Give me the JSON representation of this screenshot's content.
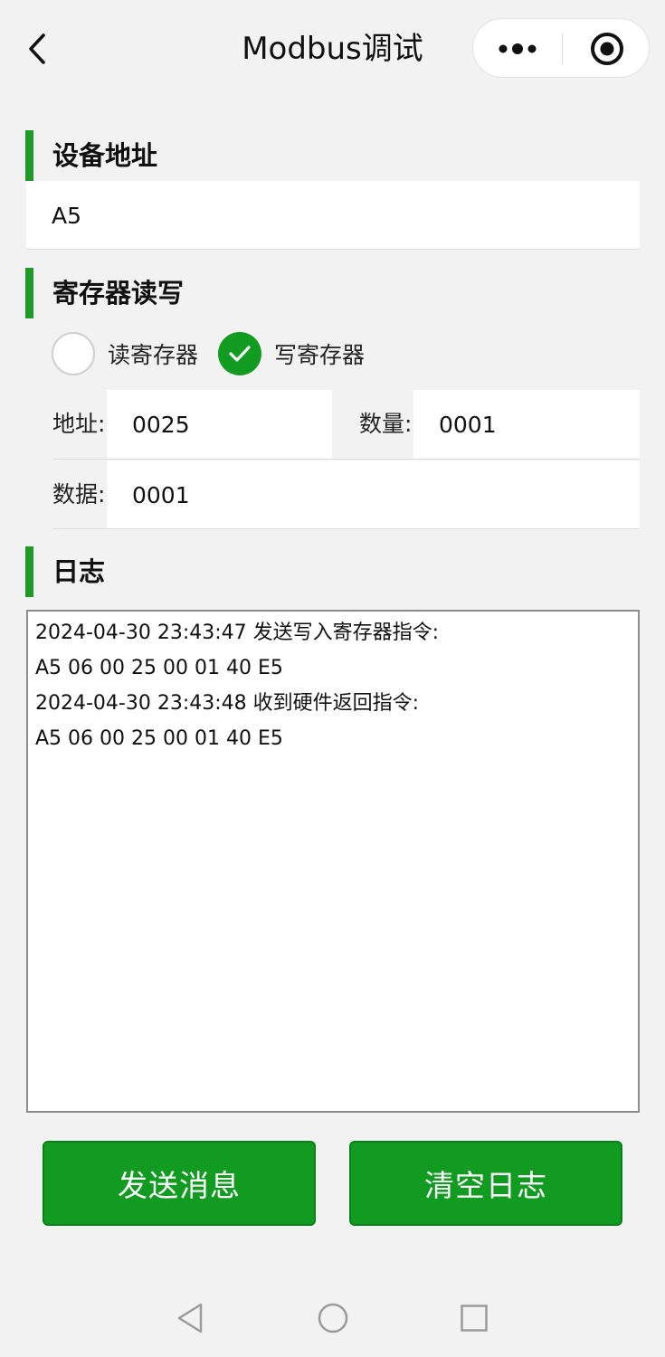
{
  "header": {
    "title": "Modbus调试",
    "back_icon": "chevron-left-icon",
    "more_icon": "more-dots-icon",
    "target_icon": "target-icon"
  },
  "device_address": {
    "heading": "设备地址",
    "value": "A5"
  },
  "register": {
    "heading": "寄存器读写",
    "options": [
      {
        "label": "读寄存器",
        "selected": false
      },
      {
        "label": "写寄存器",
        "selected": true
      }
    ],
    "address_label": "地址:",
    "address_value": "0025",
    "count_label": "数量:",
    "count_value": "0001",
    "data_label": "数据:",
    "data_value": "0001"
  },
  "log": {
    "heading": "日志",
    "lines": [
      "2024-04-30 23:43:47 发送写入寄存器指令:",
      "A5 06 00 25 00 01 40 E5",
      "2024-04-30 23:43:48 收到硬件返回指令:",
      "A5 06 00 25 00 01 40 E5"
    ]
  },
  "actions": {
    "send_label": "发送消息",
    "clear_label": "清空日志"
  },
  "colors": {
    "accent": "#119b21",
    "section_bar": "#1f9a2a",
    "background": "#f2f2f2"
  },
  "navbar": {
    "back_icon": "nav-back-icon",
    "home_icon": "nav-home-icon",
    "recents_icon": "nav-recents-icon"
  }
}
